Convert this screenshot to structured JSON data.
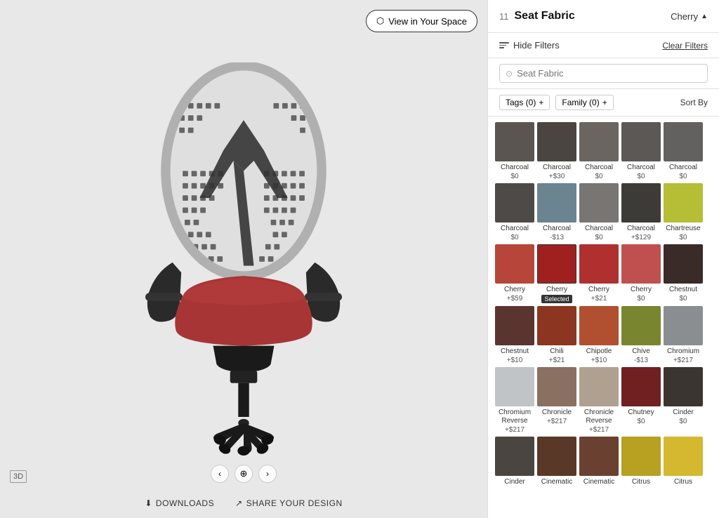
{
  "left_panel": {
    "view_in_space_btn": "View in Your Space",
    "view_icon": "🔮",
    "bottom_controls": {
      "prev_label": "‹",
      "zoom_label": "⊕",
      "next_label": "›"
    },
    "bottom_links": [
      {
        "id": "downloads",
        "icon": "⬇",
        "label": "DOWNLOADS"
      },
      {
        "id": "share",
        "icon": "⇗",
        "label": "SHARE YOUR DESIGN"
      }
    ],
    "three_d_badge": "3D"
  },
  "right_panel": {
    "step": "11",
    "title": "Seat Fabric",
    "selected_value": "Cherry",
    "filter_label": "Hide Filters",
    "clear_filters": "Clear Filters",
    "search_placeholder": "Seat Fabric",
    "tags_btn": "Tags (0)",
    "family_btn": "Family (0)",
    "sort_by_label": "Sort By",
    "colors": [
      {
        "id": "c1",
        "name": "Charcoal",
        "price": "$0",
        "color": "#5a5550",
        "selected": false
      },
      {
        "id": "c2",
        "name": "Charcoal",
        "price": "+$30",
        "color": "#4a4540",
        "selected": false
      },
      {
        "id": "c3",
        "name": "Charcoal",
        "price": "$0",
        "color": "#6a6560",
        "selected": false
      },
      {
        "id": "c4",
        "name": "Charcoal",
        "price": "$0",
        "color": "#5c5856",
        "selected": false
      },
      {
        "id": "c5",
        "name": "Charcoal",
        "price": "$0",
        "color": "#636060",
        "selected": false
      },
      {
        "id": "c6",
        "name": "Charcoal",
        "price": "$0",
        "color": "#4e4a48",
        "selected": false
      },
      {
        "id": "c7",
        "name": "Charcoal",
        "price": "-$13",
        "color": "#6a8490",
        "selected": false
      },
      {
        "id": "c8",
        "name": "Charcoal",
        "price": "$0",
        "color": "#787572",
        "selected": false
      },
      {
        "id": "c9",
        "name": "Charcoal",
        "price": "+$129",
        "color": "#3d3b38",
        "selected": false
      },
      {
        "id": "c10",
        "name": "Chartreuse",
        "price": "$0",
        "color": "#b5be35",
        "selected": false
      },
      {
        "id": "c11",
        "name": "Cherry",
        "price": "+$59",
        "color": "#b8453a",
        "selected": false
      },
      {
        "id": "c12",
        "name": "Cherry",
        "price": "Selected",
        "color": "#a02020",
        "selected": true
      },
      {
        "id": "c13",
        "name": "Cherry",
        "price": "+$21",
        "color": "#b03030",
        "selected": false
      },
      {
        "id": "c14",
        "name": "Cherry",
        "price": "$0",
        "color": "#c05050",
        "selected": false
      },
      {
        "id": "c15",
        "name": "Chestnut",
        "price": "$0",
        "color": "#3a2a28",
        "selected": false
      },
      {
        "id": "c16",
        "name": "Chestnut",
        "price": "+$10",
        "color": "#5a3530",
        "selected": false
      },
      {
        "id": "c17",
        "name": "Chili",
        "price": "+$21",
        "color": "#8c3520",
        "selected": false
      },
      {
        "id": "c18",
        "name": "Chipotle",
        "price": "+$10",
        "color": "#b05030",
        "selected": false
      },
      {
        "id": "c19",
        "name": "Chive",
        "price": "-$13",
        "color": "#7a8530",
        "selected": false
      },
      {
        "id": "c20",
        "name": "Chromium",
        "price": "+$217",
        "color": "#8a8e90",
        "selected": false
      },
      {
        "id": "c21",
        "name": "Chromium Reverse",
        "price": "+$217",
        "color": "#c0c4c6",
        "selected": false
      },
      {
        "id": "c22",
        "name": "Chronicle",
        "price": "+$217",
        "color": "#8a7060",
        "selected": false
      },
      {
        "id": "c23",
        "name": "Chronicle Reverse",
        "price": "+$217",
        "color": "#b0a090",
        "selected": false
      },
      {
        "id": "c24",
        "name": "Chutney",
        "price": "$0",
        "color": "#702020",
        "selected": false
      },
      {
        "id": "c25",
        "name": "Cinder",
        "price": "$0",
        "color": "#3a3530",
        "selected": false
      },
      {
        "id": "c26",
        "name": "Cinder",
        "price": "",
        "color": "#4a4540",
        "selected": false
      },
      {
        "id": "c27",
        "name": "Cinematic",
        "price": "",
        "color": "#5a3828",
        "selected": false
      },
      {
        "id": "c28",
        "name": "Cinematic",
        "price": "",
        "color": "#6a4030",
        "selected": false
      },
      {
        "id": "c29",
        "name": "Citrus",
        "price": "",
        "color": "#b8a020",
        "selected": false
      },
      {
        "id": "c30",
        "name": "Citrus",
        "price": "",
        "color": "#d4b830",
        "selected": false
      }
    ]
  }
}
